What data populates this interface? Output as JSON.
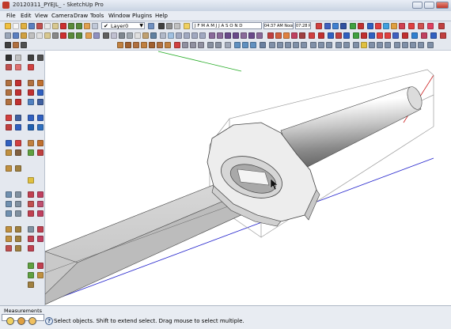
{
  "window": {
    "title": "20120311_PYEJL_ - SketchUp Pro"
  },
  "menubar": {
    "items": [
      "File",
      "Edit",
      "View",
      "Camera",
      "Draw",
      "Tools",
      "Window",
      "Plugins",
      "Help"
    ]
  },
  "toolbar": {
    "layer_check": "✔",
    "layer_name": "Layer0",
    "layer_arrow": "▼",
    "shadow_months": "J F M A M J J A S O N D",
    "time_start": "04:37 AM  Noon",
    "time_end": "07:28 PM"
  },
  "measurements": {
    "label": "Measurements",
    "value": ""
  },
  "status": {
    "help_glyph": "?",
    "message": "Select objects. Shift to extend select. Drag mouse to select multiple."
  },
  "colors": {
    "axis_red": "#cc2222",
    "axis_green": "#22aa22",
    "axis_blue": "#2222cc",
    "title_bar": "#c9d3e2"
  }
}
